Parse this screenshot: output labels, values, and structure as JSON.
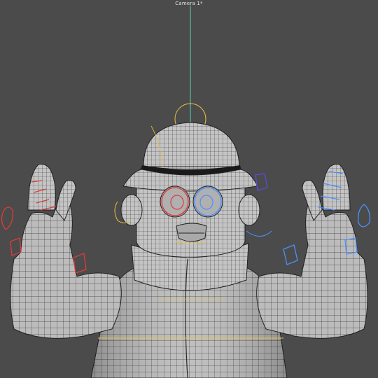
{
  "viewport": {
    "camera_label": "Camera 1*",
    "colors": {
      "background": "#4b4b4b",
      "mesh_fill": "#bdbdbd",
      "mesh_wire": "#2a2a2a",
      "up_axis": "#5fd6a8",
      "right_controls": "#4a90ff",
      "left_controls": "#e03a3a",
      "selection_gold": "#e8c040",
      "hat_brim_control": "#e8c040"
    },
    "icons": [
      "camera-icon"
    ]
  }
}
